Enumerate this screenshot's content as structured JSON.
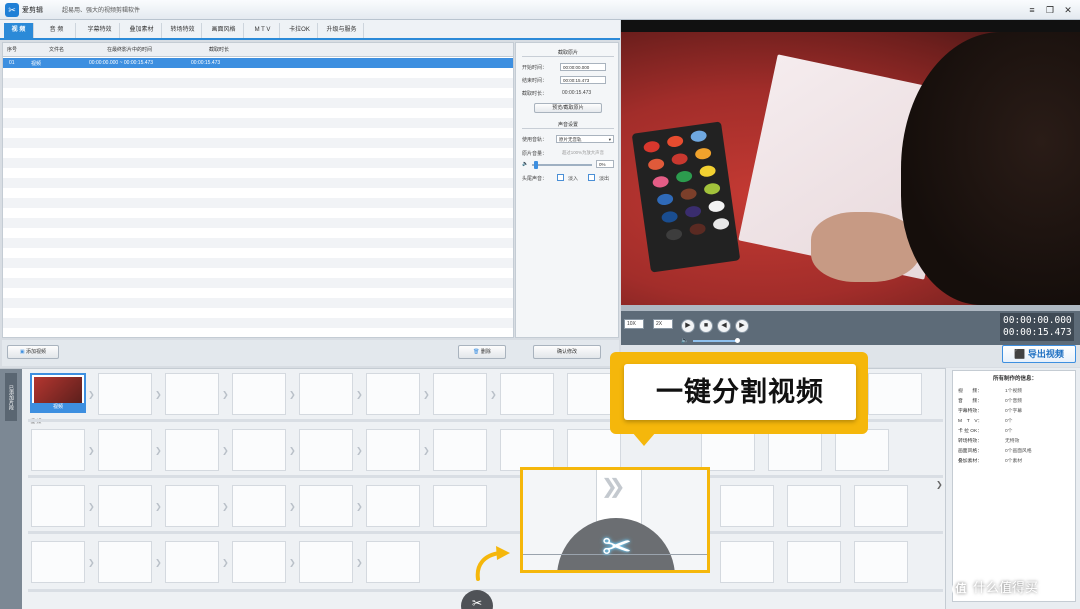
{
  "app": {
    "name": "爱剪辑",
    "slogan": "超易用、强大的视频剪辑软件"
  },
  "window_controls": {
    "menu": "≡",
    "restore": "❐",
    "close": "✕"
  },
  "tabs": [
    {
      "label": "视 频",
      "active": true
    },
    {
      "label": "音 频",
      "active": false
    },
    {
      "label": "字幕特效",
      "active": false
    },
    {
      "label": "叠加素材",
      "active": false
    },
    {
      "label": "转场特效",
      "active": false
    },
    {
      "label": "画面风格",
      "active": false
    },
    {
      "label": "M T V",
      "active": false
    },
    {
      "label": "卡拉OK",
      "active": false
    },
    {
      "label": "升级与服务",
      "active": false
    }
  ],
  "file_table": {
    "columns": [
      "序号",
      "文件名",
      "在最终影片中的时间",
      "截取时长"
    ],
    "rows": [
      {
        "index": "01",
        "name": "视频",
        "time": "00:00:00.000 ~ 00:00:15.473",
        "duration": "00:00:15.473"
      }
    ]
  },
  "settings": {
    "cut_section": "截取原片",
    "start_label": "开始时间：",
    "start_value": "00:00:00.000",
    "end_label": "结束时间：",
    "end_value": "00:00:15.473",
    "dur_label": "截取时长：",
    "dur_value": "00:00:15.473",
    "preview_btn": "预览/截取原片",
    "audio_section": "声音设置",
    "track_label": "使用音轨：",
    "track_value": "原片无音轨",
    "volume_label": "原片音量：",
    "volume_hint": "超过100%为放大声音",
    "volume_value": "0%",
    "fade_label": "头尾声音：",
    "fade_in": "淡入",
    "fade_out": "淡出"
  },
  "buttons": {
    "add_video": "添加视频",
    "delete": "删除",
    "confirm": "确认修改",
    "export": "导出视频"
  },
  "player": {
    "speed_a": "10X",
    "speed_b": "2X",
    "timecode_current": "00:00:00.000",
    "timecode_total": "00:00:15.473"
  },
  "timeline": {
    "vertical_tab": "已添加片段",
    "clip_name": "视频",
    "hint": "双击此处添加视频",
    "track_label": "视 频"
  },
  "info_panel": {
    "title": "所有制作的信息：",
    "rows": [
      {
        "k": "视　　频：",
        "v": "1个视频"
      },
      {
        "k": "音　　频：",
        "v": "0个音频"
      },
      {
        "k": "字幕特效：",
        "v": "0个字幕"
      },
      {
        "k": "M　T　V：",
        "v": "0个"
      },
      {
        "k": "卡 拉 OK：",
        "v": "0个"
      },
      {
        "k": "转场特效：",
        "v": "无特效"
      },
      {
        "k": "画面风格：",
        "v": "0个画面风格"
      },
      {
        "k": "叠加素材：",
        "v": "0个素材"
      }
    ]
  },
  "callout": {
    "text": "一键分割视频"
  },
  "icons": {
    "scissor": "✂",
    "arrows": "❯❯"
  },
  "watermark": {
    "icon_text": "值",
    "text": "什么值得买"
  },
  "colors": {
    "accent": "#2b8ad8",
    "highlight": "#f5b70b"
  }
}
